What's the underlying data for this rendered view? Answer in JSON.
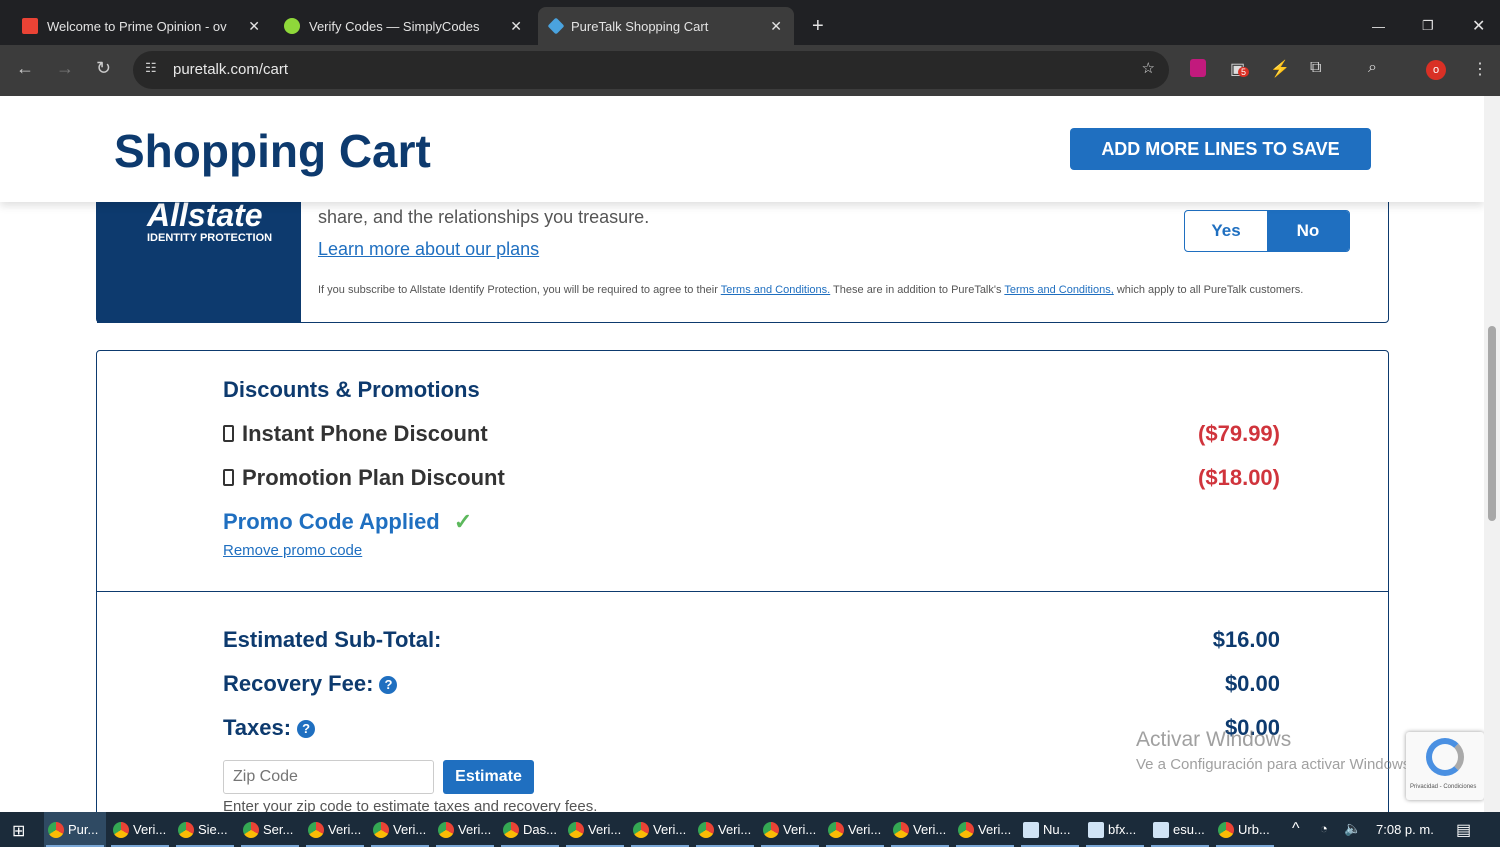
{
  "browser": {
    "tabs": [
      {
        "title": "Welcome to Prime Opinion - ov"
      },
      {
        "title": "Verify Codes — SimplyCodes"
      },
      {
        "title": "PureTalk Shopping Cart"
      }
    ],
    "url": "puretalk.com/cart",
    "ext_badge": "5",
    "profile": "o"
  },
  "header": {
    "title": "Shopping Cart",
    "cta": "ADD MORE LINES TO SAVE"
  },
  "allstate": {
    "brand": "Allstate",
    "sub": "IDENTITY PROTECTION",
    "text": "share, and the relationships you treasure.",
    "learn": "Learn more about our plans",
    "yes": "Yes",
    "no": "No",
    "disc1": "If you subscribe to Allstate Identify Protection, you will be required to agree to their ",
    "terms1": "Terms and Conditions.",
    "disc2": " These are in addition to PureTalk's ",
    "terms2": "Terms and Conditions,",
    "disc3": " which apply to all PureTalk customers."
  },
  "discounts": {
    "heading": "Discounts & Promotions",
    "items": [
      {
        "label": "Instant Phone Discount",
        "amount": "($79.99)"
      },
      {
        "label": "Promotion Plan Discount",
        "amount": "($18.00)"
      }
    ],
    "promo": "Promo Code Applied",
    "remove": "Remove promo code"
  },
  "totals": {
    "subtotal_label": "Estimated Sub-Total:",
    "subtotal": "$16.00",
    "recovery_label": "Recovery Fee:",
    "recovery": "$0.00",
    "taxes_label": "Taxes:",
    "taxes": "$0.00",
    "zip_placeholder": "Zip Code",
    "estimate": "Estimate",
    "hint": "Enter your zip code to estimate taxes and recovery fees.",
    "help": "?"
  },
  "watermark": {
    "line1": "Activar Windows",
    "line2": "Ve a Configuración para activar Windows."
  },
  "recaptcha": "Privacidad - Condiciones",
  "taskbar": {
    "items": [
      "Pur...",
      "Veri...",
      "Sie...",
      "Ser...",
      "Veri...",
      "Veri...",
      "Veri...",
      "Das...",
      "Veri...",
      "Veri...",
      "Veri...",
      "Veri...",
      "Veri...",
      "Veri...",
      "Veri...",
      "Nu...",
      "bfx...",
      "esu...",
      "Urb..."
    ],
    "time": "7:08 p. m."
  }
}
